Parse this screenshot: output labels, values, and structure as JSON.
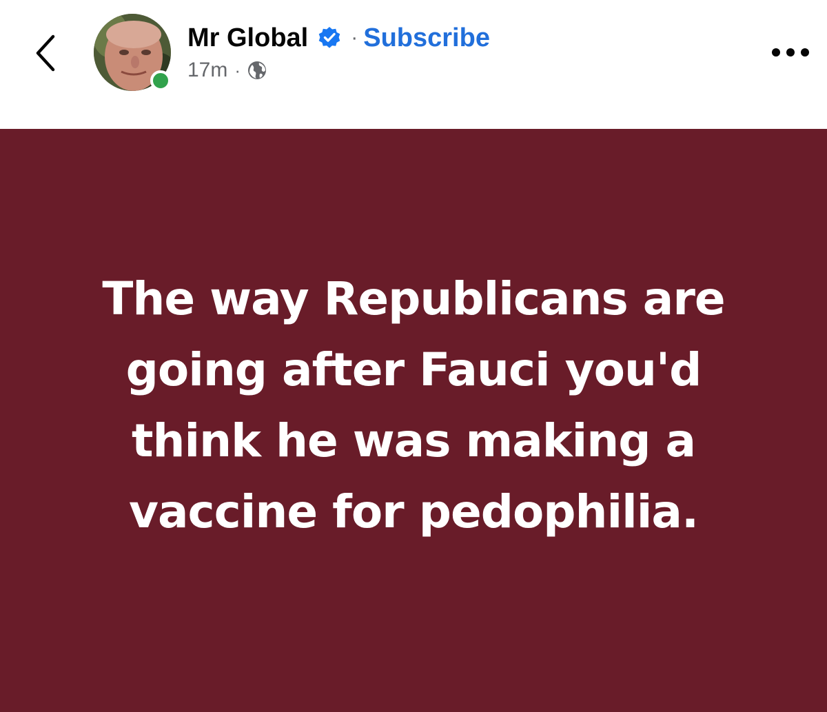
{
  "header": {
    "author_name": "Mr Global",
    "separator": "·",
    "subscribe_label": "Subscribe",
    "timestamp": "17m",
    "meta_separator": "·",
    "icons": {
      "back": "chevron-left-icon",
      "verified": "verified-badge-icon",
      "audience": "globe-icon",
      "more": "more-horizontal-icon"
    }
  },
  "post": {
    "text": "The way Republicans are going after Fauci you'd think he was making a vaccine for pedophilia.",
    "background_color": "#691c29",
    "text_color": "#ffffff"
  },
  "colors": {
    "link_blue": "#216fdb",
    "verified_blue": "#1877f2",
    "online_green": "#31a24c",
    "meta_gray": "#65676b"
  }
}
